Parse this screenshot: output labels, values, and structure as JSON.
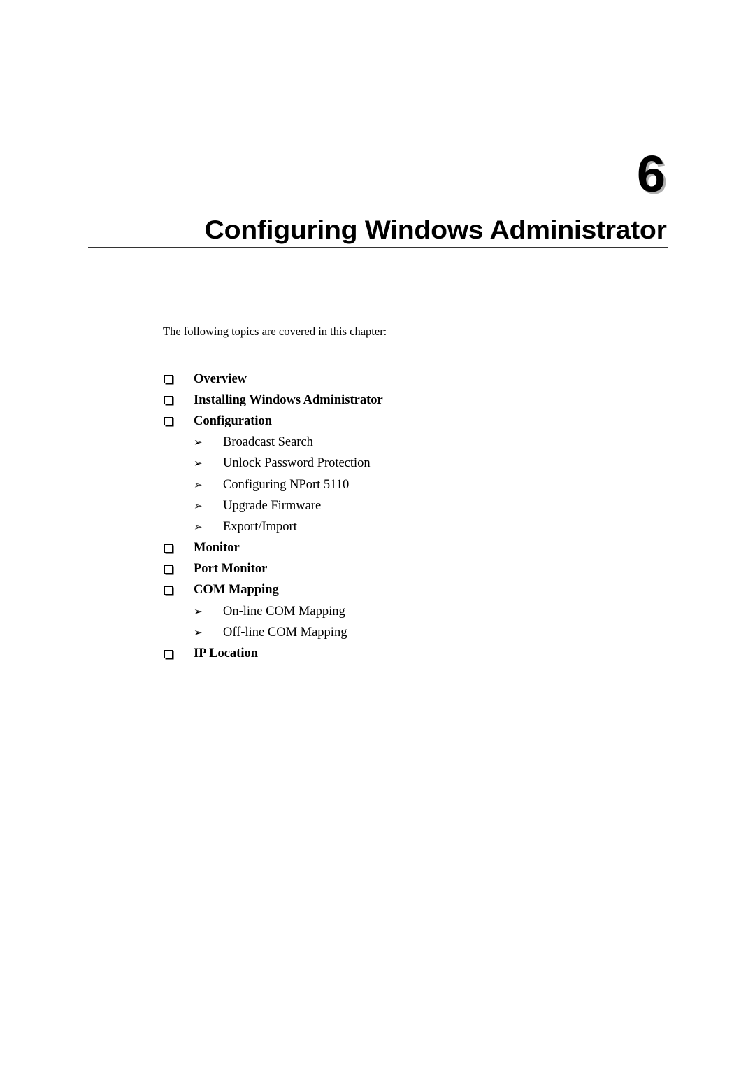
{
  "chapter": {
    "number": "6",
    "title": "Configuring Windows Administrator"
  },
  "intro": "The following topics are covered in this chapter:",
  "topics": [
    {
      "level": "main",
      "icon": "checkbox-icon",
      "label": "Overview"
    },
    {
      "level": "main",
      "icon": "checkbox-icon",
      "label": "Installing Windows Administrator"
    },
    {
      "level": "main",
      "icon": "checkbox-icon",
      "label": "Configuration"
    },
    {
      "level": "sub",
      "icon": "arrowhead-bullet-icon",
      "label": "Broadcast Search"
    },
    {
      "level": "sub",
      "icon": "arrowhead-bullet-icon",
      "label": "Unlock Password Protection"
    },
    {
      "level": "sub",
      "icon": "arrowhead-bullet-icon",
      "label": "Configuring NPort 5110"
    },
    {
      "level": "sub",
      "icon": "arrowhead-bullet-icon",
      "label": "Upgrade Firmware"
    },
    {
      "level": "sub",
      "icon": "arrowhead-bullet-icon",
      "label": "Export/Import"
    },
    {
      "level": "main",
      "icon": "checkbox-icon",
      "label": "Monitor"
    },
    {
      "level": "main",
      "icon": "checkbox-icon",
      "label": "Port Monitor"
    },
    {
      "level": "main",
      "icon": "checkbox-icon",
      "label": "COM Mapping"
    },
    {
      "level": "sub",
      "icon": "arrowhead-bullet-icon",
      "label": "On-line COM Mapping"
    },
    {
      "level": "sub",
      "icon": "arrowhead-bullet-icon",
      "label": "Off-line COM Mapping"
    },
    {
      "level": "main",
      "icon": "checkbox-icon",
      "label": "IP Location"
    }
  ],
  "glyphs": {
    "arrow": "➢"
  }
}
